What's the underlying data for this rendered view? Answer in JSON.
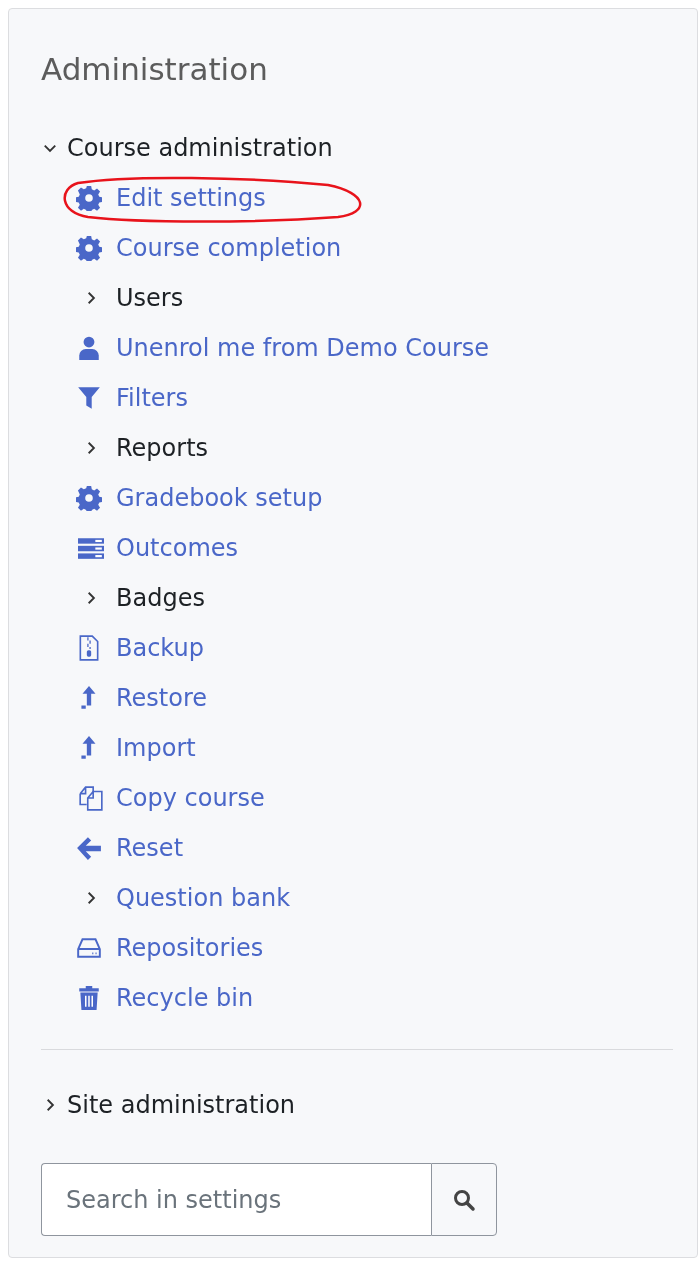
{
  "title": "Administration",
  "course_admin": {
    "label": "Course administration",
    "expanded": true,
    "items": [
      {
        "kind": "gear",
        "label": "Edit settings",
        "link": true,
        "circled": true
      },
      {
        "kind": "gear",
        "label": "Course completion",
        "link": true,
        "circled": false
      },
      {
        "kind": "branch",
        "label": "Users",
        "link": false,
        "expanded": false,
        "circled": false
      },
      {
        "kind": "user",
        "label": "Unenrol me from Demo Course",
        "link": true,
        "circled": false
      },
      {
        "kind": "filter",
        "label": "Filters",
        "link": true,
        "circled": false
      },
      {
        "kind": "branch",
        "label": "Reports",
        "link": false,
        "expanded": false,
        "circled": false
      },
      {
        "kind": "gear",
        "label": "Gradebook setup",
        "link": true,
        "circled": false
      },
      {
        "kind": "list",
        "label": "Outcomes",
        "link": true,
        "circled": false
      },
      {
        "kind": "branch",
        "label": "Badges",
        "link": false,
        "expanded": false,
        "circled": false
      },
      {
        "kind": "archive",
        "label": "Backup",
        "link": true,
        "circled": false
      },
      {
        "kind": "upload",
        "label": "Restore",
        "link": true,
        "circled": false
      },
      {
        "kind": "upload",
        "label": "Import",
        "link": true,
        "circled": false
      },
      {
        "kind": "copy",
        "label": "Copy course",
        "link": true,
        "circled": false
      },
      {
        "kind": "back",
        "label": "Reset",
        "link": true,
        "circled": false
      },
      {
        "kind": "branch",
        "label": "Question bank",
        "link": true,
        "expanded": false,
        "circled": false
      },
      {
        "kind": "drive",
        "label": "Repositories",
        "link": true,
        "circled": false
      },
      {
        "kind": "trash",
        "label": "Recycle bin",
        "link": true,
        "circled": false
      }
    ]
  },
  "site_admin": {
    "label": "Site administration",
    "expanded": false
  },
  "search": {
    "placeholder": "Search in settings"
  }
}
